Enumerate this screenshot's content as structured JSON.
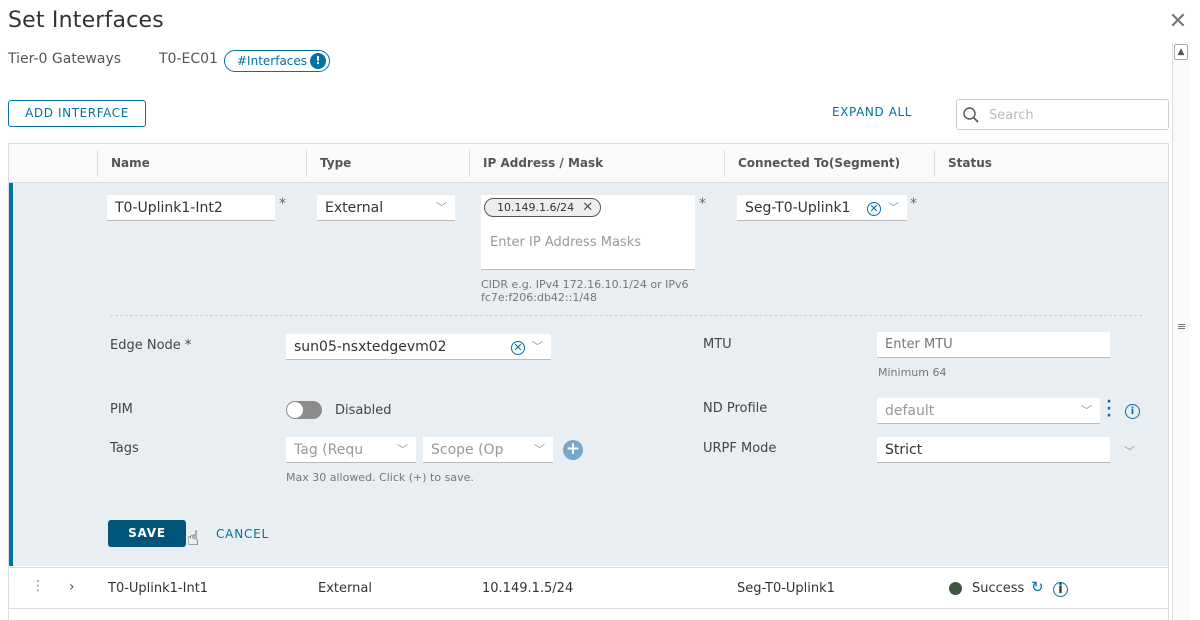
{
  "dialog": {
    "title": "Set Interfaces",
    "close_icon": "close-icon"
  },
  "breadcrumb": {
    "gateway_type": "Tier-0 Gateways",
    "gateway_name": "T0-EC01",
    "pill_label": "#Interfaces",
    "pill_badge": "!"
  },
  "toolbar": {
    "add_label": "ADD INTERFACE",
    "expand_label": "EXPAND ALL",
    "search_placeholder": "Search"
  },
  "table": {
    "columns": [
      "Name",
      "Type",
      "IP Address / Mask",
      "Connected To(Segment)",
      "Status"
    ]
  },
  "edit_row": {
    "name_value": "T0-Uplink1-Int2",
    "type_value": "External",
    "ip_chip": "10.149.1.6/24",
    "ip_placeholder": "Enter IP Address Masks",
    "ip_hint": "CIDR e.g. IPv4 172.16.10.1/24 or IPv6 fc7e:f206:db42::1/48",
    "segment_value": "Seg-T0-Uplink1",
    "required_mark": "*",
    "edge_node_label": "Edge Node *",
    "edge_node_value": "sun05-nsxtedgevm02",
    "mtu_label": "MTU",
    "mtu_placeholder": "Enter MTU",
    "mtu_hint": "Minimum 64",
    "pim_label": "PIM",
    "pim_status": "Disabled",
    "pim_enabled": false,
    "nd_profile_label": "ND Profile",
    "nd_profile_value": "default",
    "tags_label": "Tags",
    "tag_placeholder": "Tag (Requ",
    "scope_placeholder": "Scope (Op",
    "tags_hint": "Max 30 allowed. Click (+) to save.",
    "urpf_label": "URPF Mode",
    "urpf_value": "Strict",
    "save_label": "SAVE",
    "cancel_label": "CANCEL"
  },
  "rows": [
    {
      "name": "T0-Uplink1-Int1",
      "type": "External",
      "ip": "10.149.1.5/24",
      "segment": "Seg-T0-Uplink1",
      "status": "Success",
      "status_color": "#3e5540"
    }
  ],
  "colors": {
    "accent": "#0072a3",
    "save_bg": "#00567a",
    "edit_bg": "#e9eef2"
  }
}
